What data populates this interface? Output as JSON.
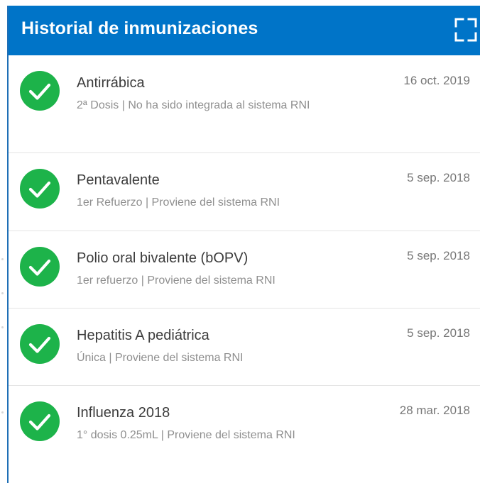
{
  "header": {
    "title": "Historial de inmunizaciones",
    "expand_icon": "fullscreen-expand-icon"
  },
  "colors": {
    "header_bg": "#0074C8",
    "check_green": "#1DB34A",
    "title_text": "#FFFFFF",
    "name_text": "#3C3C3C",
    "detail_text": "#8F8F8F",
    "divider": "#E4E4E4"
  },
  "immunizations": [
    {
      "name": "Antirrábica",
      "detail": "2ª Dosis | No ha sido integrada al sistema RNI",
      "date": "16 oct. 2019",
      "status_icon": "check-circle-icon"
    },
    {
      "name": "Pentavalente",
      "detail": "1er Refuerzo | Proviene del sistema RNI",
      "date": "5 sep. 2018",
      "status_icon": "check-circle-icon"
    },
    {
      "name": "Polio oral bivalente (bOPV)",
      "detail": "1er refuerzo | Proviene del sistema RNI",
      "date": "5 sep. 2018",
      "status_icon": "check-circle-icon"
    },
    {
      "name": "Hepatitis A pediátrica",
      "detail": "Única | Proviene del sistema RNI",
      "date": "5 sep. 2018",
      "status_icon": "check-circle-icon"
    },
    {
      "name": "Influenza 2018",
      "detail": "1° dosis 0.25mL | Proviene del sistema RNI",
      "date": "28 mar. 2018",
      "status_icon": "check-circle-icon"
    }
  ]
}
